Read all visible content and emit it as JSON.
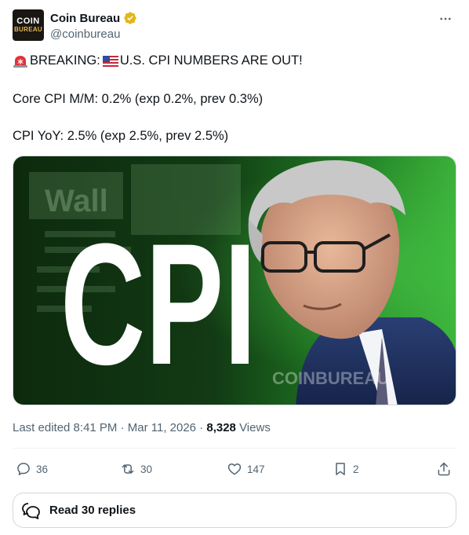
{
  "author": {
    "avatar_line1": "COIN",
    "avatar_line2": "BUREAU",
    "name": "Coin Bureau",
    "handle": "@coinbureau"
  },
  "tweet": {
    "line1_text": "BREAKING: ",
    "line1_text2": "U.S. CPI NUMBERS ARE OUT!",
    "line2": "Core CPI M/M: 0.2% (exp 0.2%, prev 0.3%)",
    "line3": "CPI YoY: 2.5% (exp 2.5%, prev 2.5%)",
    "emoji_names": [
      "police-light-emoji",
      "us-flag-emoji"
    ]
  },
  "media": {
    "headline": "CPI",
    "bg_word": "Wall",
    "watermark": "COINBUREAU",
    "accent_green": "#2e9a2e"
  },
  "meta": {
    "edited": "Last edited 8:41 PM · Mar 11, 2026 · ",
    "views_count": "8,328",
    "views_label": " Views"
  },
  "actions": {
    "replies": "36",
    "reposts": "30",
    "likes": "147",
    "bookmarks": "2"
  },
  "read_replies_label": "Read 30 replies",
  "colors": {
    "text": "#0f1419",
    "secondary": "#536471",
    "verified_gold": "#e2b719",
    "border": "#cfd9de"
  }
}
